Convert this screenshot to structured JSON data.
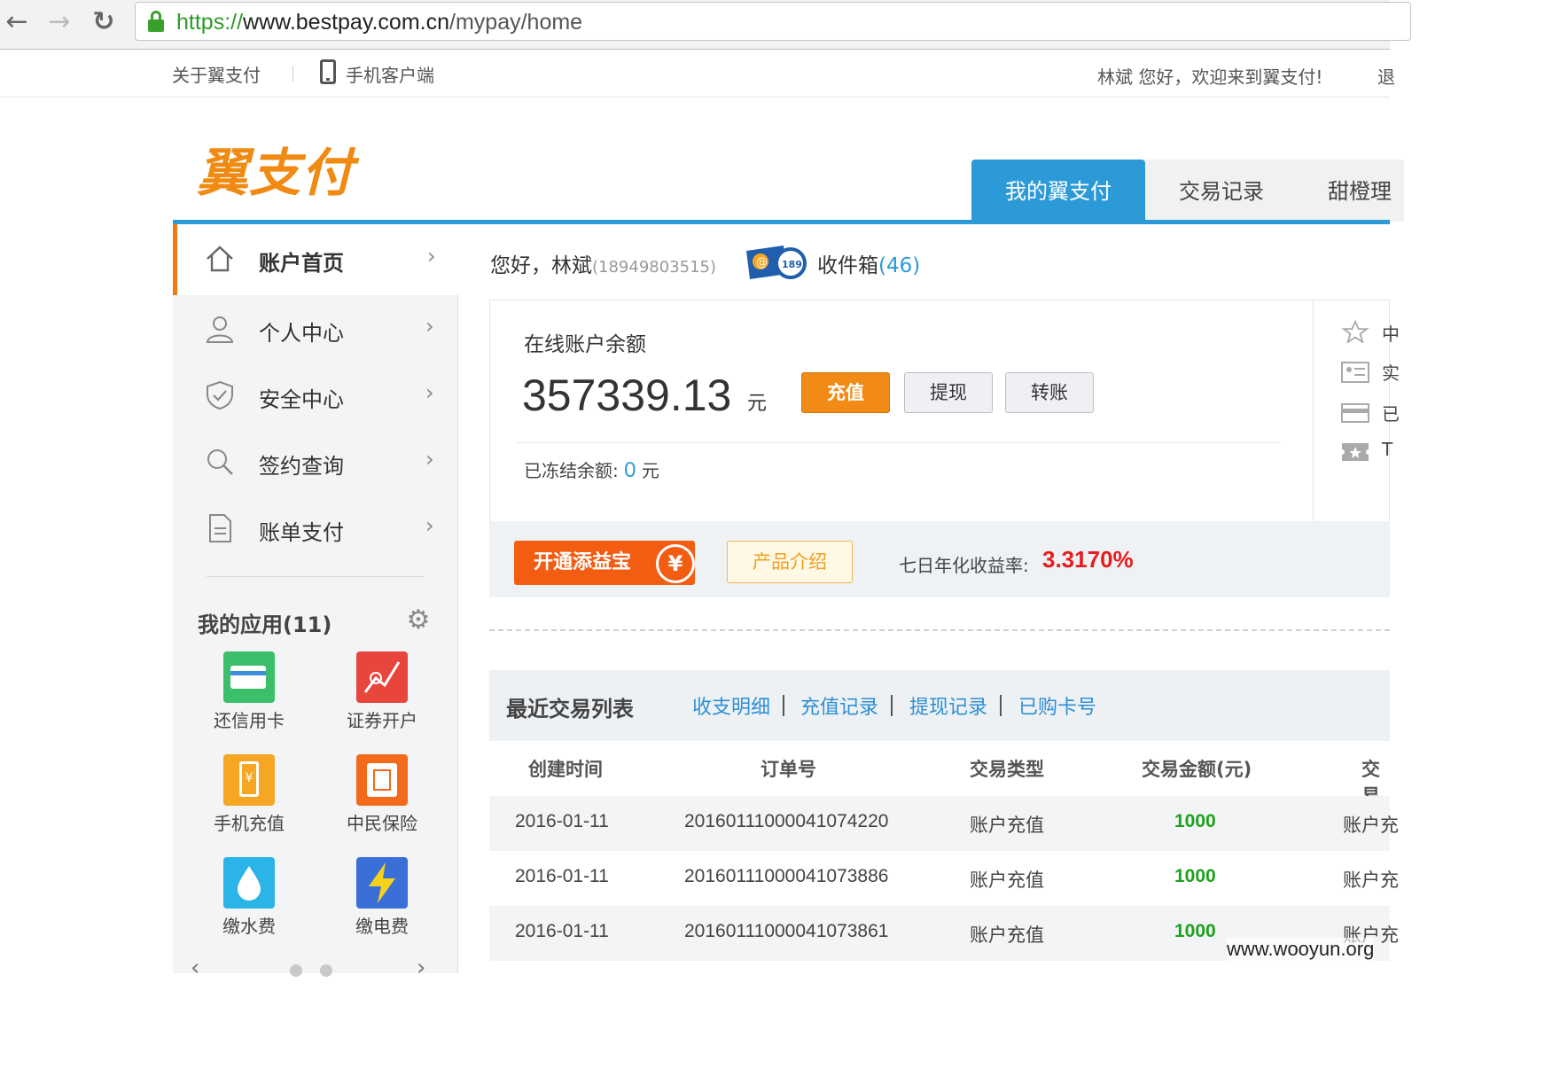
{
  "browser": {
    "url_scheme": "https://",
    "url_domain": "www.bestpay.com.cn",
    "url_path": "/mypay/home",
    "back_glyph": "←",
    "forward_glyph": "→",
    "reload_glyph": "↻"
  },
  "topbar": {
    "about": "关于翼支付",
    "mobile_client": "手机客户端",
    "welcome": "林斌 您好，欢迎来到翼支付!",
    "logout_partial": "退"
  },
  "header": {
    "logo": "翼支付",
    "tabs": [
      {
        "label": "我的翼支付",
        "active": true
      },
      {
        "label": "交易记录",
        "active": false
      },
      {
        "label": "甜橙理",
        "active": false
      }
    ]
  },
  "sidebar": {
    "items": [
      {
        "label": "账户首页",
        "icon": "home-icon"
      },
      {
        "label": "个人中心",
        "icon": "user-icon"
      },
      {
        "label": "安全中心",
        "icon": "shield-icon"
      },
      {
        "label": "签约查询",
        "icon": "search-icon"
      },
      {
        "label": "账单支付",
        "icon": "document-icon"
      }
    ],
    "chevron": "›",
    "apps_title": "我的应用(11)",
    "apps": [
      {
        "label": "还信用卡",
        "icon": "credit-card-icon",
        "color": "#3bbf6a"
      },
      {
        "label": "证券开户",
        "icon": "stock-icon",
        "color": "#e8453c"
      },
      {
        "label": "手机充值",
        "icon": "phone-recharge-icon",
        "color": "#f5a623"
      },
      {
        "label": "中民保险",
        "icon": "insurance-icon",
        "color": "#f26a1b"
      },
      {
        "label": "缴水费",
        "icon": "water-drop-icon",
        "color": "#2ab4e8"
      },
      {
        "label": "缴电费",
        "icon": "lightning-icon",
        "color": "#3a6fd8"
      }
    ],
    "carousel_prev": "‹",
    "carousel_next": "›"
  },
  "greeting": {
    "text": "您好，林斌",
    "phone": "(18949803515)",
    "inbox_label": "收件箱",
    "inbox_count": "(46)"
  },
  "balance": {
    "title": "在线账户余额",
    "amount": "357339.13",
    "unit": "元",
    "recharge": "充值",
    "withdraw": "提现",
    "transfer": "转账",
    "frozen_label": "已冻结余额:",
    "frozen_value": "0",
    "frozen_unit": "元",
    "right_items": [
      "中",
      "实",
      "已",
      "T"
    ]
  },
  "tianyibao": {
    "open": "开通添益宝",
    "coin": "¥",
    "intro": "产品介绍",
    "yield_label": "七日年化收益率:",
    "yield_value": "3.3170%"
  },
  "transactions": {
    "title": "最近交易列表",
    "links": [
      "收支明细",
      "充值记录",
      "提现记录",
      "已购卡号"
    ],
    "columns": [
      "创建时间",
      "订单号",
      "交易类型",
      "交易金额(元)",
      "交易"
    ],
    "rows": [
      {
        "date": "2016-01-11",
        "order": "20160111000041074220",
        "type": "账户充值",
        "amount": "1000",
        "extra": "账户充"
      },
      {
        "date": "2016-01-11",
        "order": "20160111000041073886",
        "type": "账户充值",
        "amount": "1000",
        "extra": "账户充"
      },
      {
        "date": "2016-01-11",
        "order": "20160111000041073861",
        "type": "账户充值",
        "amount": "1000",
        "extra": "账户充"
      }
    ]
  },
  "watermark": "www.wooyun.org"
}
